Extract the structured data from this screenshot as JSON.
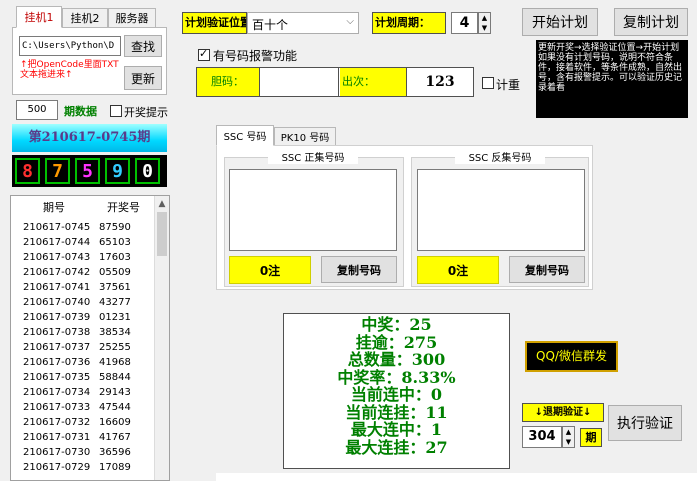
{
  "tabs": [
    "挂机1",
    "挂机2",
    "服务器"
  ],
  "path_value": "C:\\Users\\Python\\D",
  "find_label": "查找",
  "hint_text": "↑把OpenCode里面TXT文本拖进来↑",
  "update_label": "更新",
  "period_count": "500",
  "period_label": "期数据",
  "draw_notice_label": "开奖提示",
  "issue_title": "第210617-0745期",
  "digits": [
    {
      "value": "8",
      "color": "#ff3030"
    },
    {
      "value": "7",
      "color": "#ff9900"
    },
    {
      "value": "5",
      "color": "#ff33ff"
    },
    {
      "value": "9",
      "color": "#33ccff"
    },
    {
      "value": "0",
      "color": "#ffffff"
    }
  ],
  "history": {
    "headers": [
      "期号",
      "开奖号"
    ],
    "rows": [
      [
        "210617-0745",
        "87590"
      ],
      [
        "210617-0744",
        "65103"
      ],
      [
        "210617-0743",
        "17603"
      ],
      [
        "210617-0742",
        "05509"
      ],
      [
        "210617-0741",
        "37561"
      ],
      [
        "210617-0740",
        "43277"
      ],
      [
        "210617-0739",
        "01231"
      ],
      [
        "210617-0738",
        "38534"
      ],
      [
        "210617-0737",
        "25255"
      ],
      [
        "210617-0736",
        "41968"
      ],
      [
        "210617-0735",
        "58844"
      ],
      [
        "210617-0734",
        "29143"
      ],
      [
        "210617-0733",
        "47544"
      ],
      [
        "210617-0732",
        "16609"
      ],
      [
        "210617-0731",
        "41767"
      ],
      [
        "210617-0730",
        "36596"
      ],
      [
        "210617-0729",
        "17089"
      ]
    ]
  },
  "plan_position_label": "计划验证位置：",
  "plan_position_value": "百十个",
  "plan_cycle_label": "计划周期：",
  "plan_cycle_value": "4",
  "start_plan_label": "开始计划",
  "copy_plan_label": "复制计划",
  "alarm_label": "有号码报警功能",
  "bile_label": "胆码：",
  "bile_value": "",
  "times_label": "出次：",
  "times_value": "123",
  "counter_label": "计重",
  "info_text": "更新开奖→选择验证位置→开始计划\n如果没有计划号码，说明不符合条件，接着软件，等条件成熟，自然出号，含有报警提示。可以验证历史记录着看",
  "code_tabs": [
    "SSC 号码",
    "PK10 号码"
  ],
  "positive_title": "SSC 正集号码",
  "negative_title": "SSC 反集号码",
  "positive_count": "0注",
  "negative_count": "0注",
  "copy_code_label": "复制号码",
  "stats": {
    "win": "中奖：25",
    "miss": "挂逾：275",
    "total": "总数量：300",
    "rate": "中奖率：8.33%",
    "cur_win": "当前连中：0",
    "cur_miss": "当前连挂：11",
    "max_win": "最大连中：1",
    "max_miss": "最大连挂：27"
  },
  "qq_label": "QQ/微信群发",
  "backtest_label": "↓退期验证↓",
  "backtest_value": "304",
  "backtest_unit": "期",
  "execute_label": "执行验证"
}
